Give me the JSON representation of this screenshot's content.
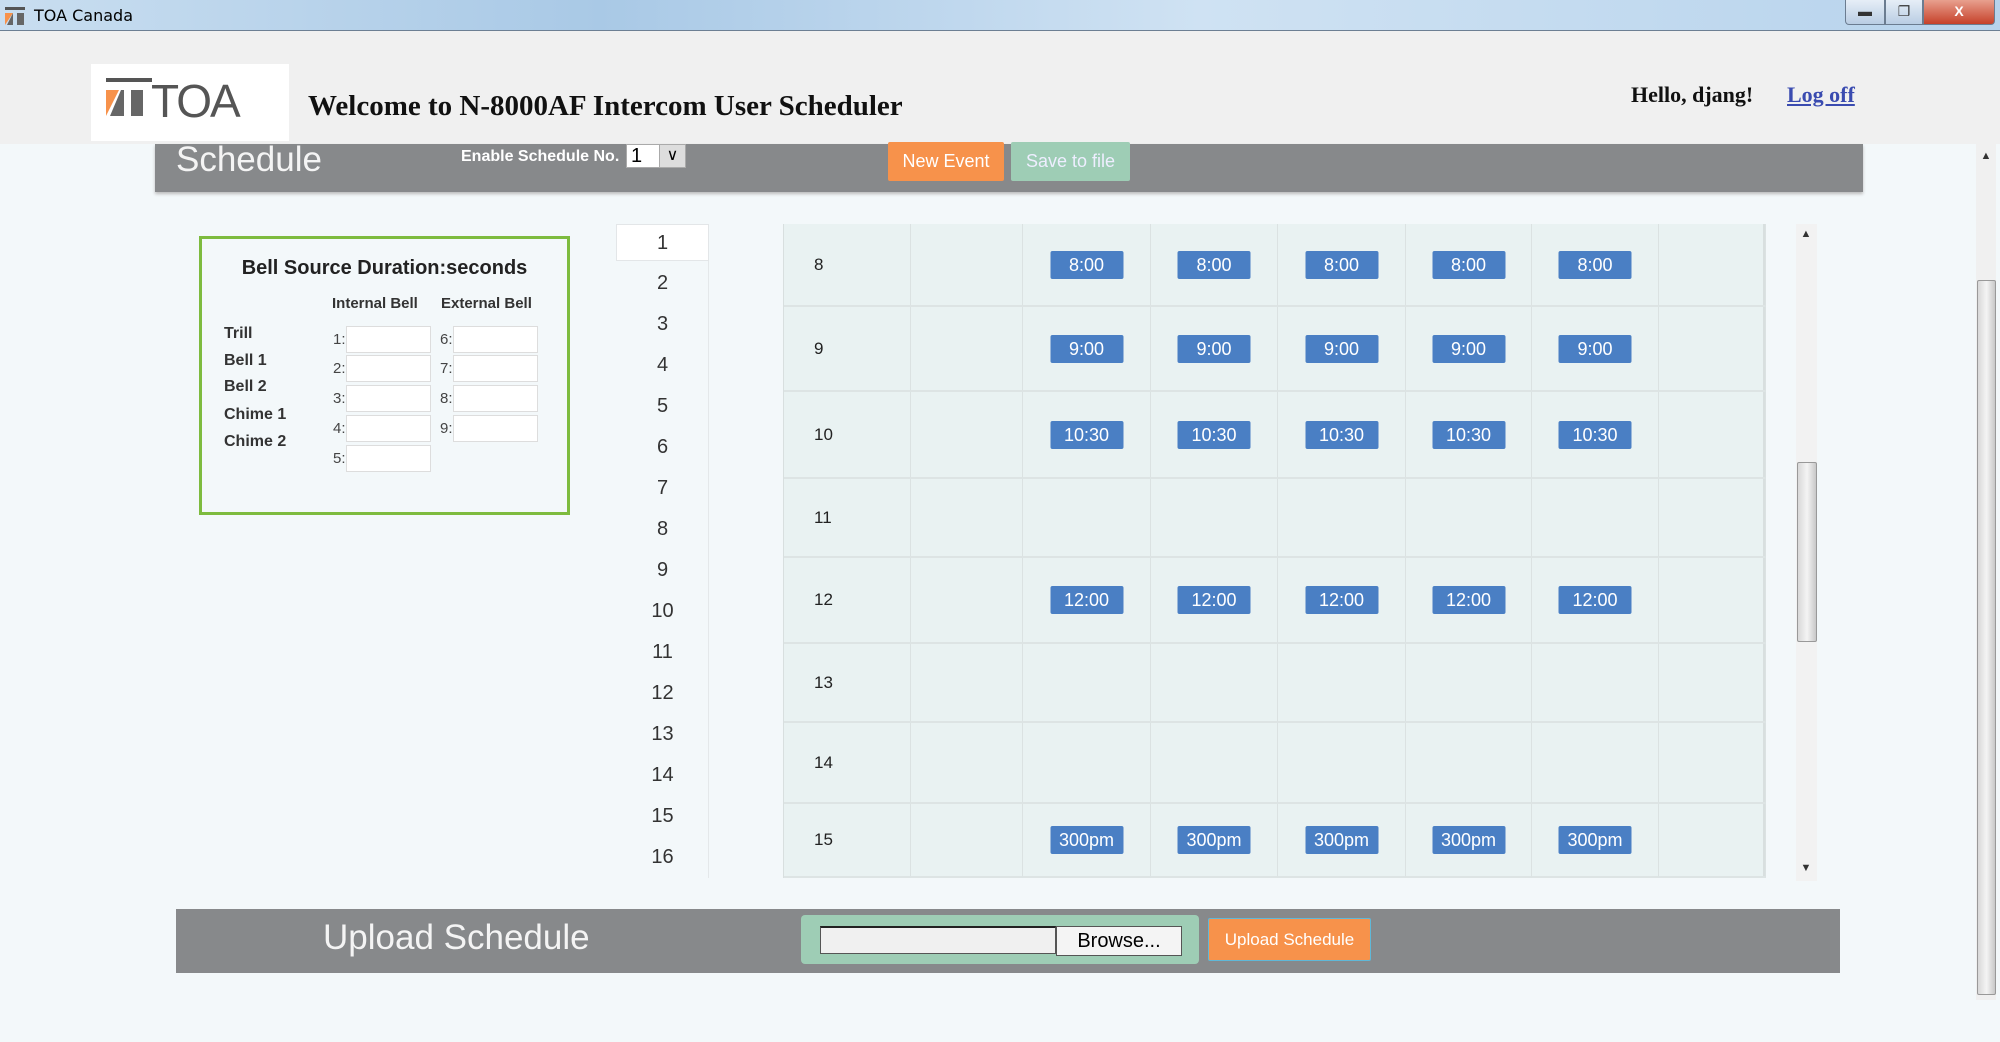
{
  "window": {
    "title": "TOA Canada",
    "controls": [
      "minimize",
      "restore",
      "close"
    ]
  },
  "header": {
    "logo_text": "TOA",
    "welcome": "Welcome to N-8000AF Intercom User Scheduler",
    "greeting": "Hello, djang!",
    "logoff": "Log off"
  },
  "schedule": {
    "title": "Schedule",
    "enable_label": "Enable Schedule No.",
    "enable_value": "1",
    "new_event": "New Event",
    "save_to_file": "Save to file"
  },
  "bell": {
    "title": "Bell Source Duration:seconds",
    "internal_header": "Internal Bell",
    "external_header": "External Bell",
    "rows": [
      "Trill",
      "Bell 1",
      "Bell 2",
      "Chime 1",
      "Chime 2"
    ],
    "internal_fields": [
      {
        "label": "1:",
        "value": ""
      },
      {
        "label": "2:",
        "value": ""
      },
      {
        "label": "3:",
        "value": ""
      },
      {
        "label": "4:",
        "value": ""
      },
      {
        "label": "5:",
        "value": ""
      }
    ],
    "external_fields": [
      {
        "label": "6:",
        "value": ""
      },
      {
        "label": "7:",
        "value": ""
      },
      {
        "label": "8:",
        "value": ""
      },
      {
        "label": "9:",
        "value": ""
      }
    ]
  },
  "schedule_numbers": {
    "selected": "1",
    "items": [
      "1",
      "2",
      "3",
      "4",
      "5",
      "6",
      "7",
      "8",
      "9",
      "10",
      "11",
      "12",
      "13",
      "14",
      "15",
      "16"
    ]
  },
  "grid": {
    "rows": [
      {
        "hour": "8",
        "events": [
          "",
          "8:00",
          "8:00",
          "8:00",
          "8:00",
          "8:00",
          ""
        ]
      },
      {
        "hour": "9",
        "events": [
          "",
          "9:00",
          "9:00",
          "9:00",
          "9:00",
          "9:00",
          ""
        ]
      },
      {
        "hour": "10",
        "events": [
          "",
          "10:30",
          "10:30",
          "10:30",
          "10:30",
          "10:30",
          ""
        ]
      },
      {
        "hour": "11",
        "events": [
          "",
          "",
          "",
          "",
          "",
          "",
          ""
        ]
      },
      {
        "hour": "12",
        "events": [
          "",
          "12:00",
          "12:00",
          "12:00",
          "12:00",
          "12:00",
          ""
        ]
      },
      {
        "hour": "13",
        "events": [
          "",
          "",
          "",
          "",
          "",
          "",
          ""
        ]
      },
      {
        "hour": "14",
        "events": [
          "",
          "",
          "",
          "",
          "",
          "",
          ""
        ]
      },
      {
        "hour": "15",
        "events": [
          "",
          "300pm",
          "300pm",
          "300pm",
          "300pm",
          "300pm",
          ""
        ]
      }
    ]
  },
  "upload": {
    "title": "Upload Schedule",
    "file_value": "",
    "browse": "Browse...",
    "button": "Upload Schedule"
  },
  "colors": {
    "accent_orange": "#f7924b",
    "event_blue": "#4a7fc4",
    "bar_gray": "#87898b",
    "save_green": "#9ecdb5",
    "bell_border": "#7dbb3e"
  }
}
